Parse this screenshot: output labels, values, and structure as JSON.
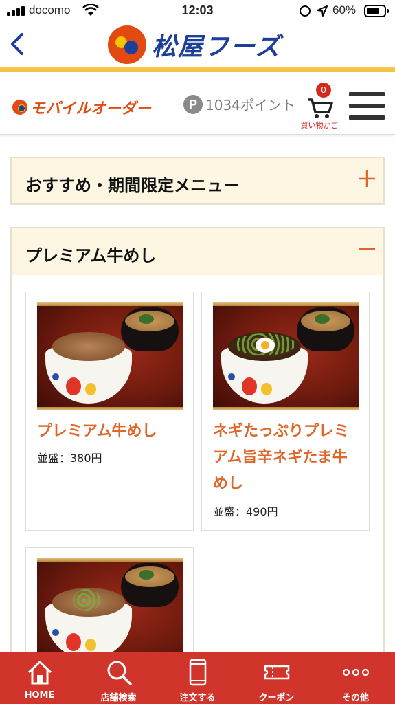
{
  "status_bar": {
    "carrier": "docomo",
    "time": "12:03",
    "battery": "60%"
  },
  "header": {
    "brand_name": "松屋フーズ"
  },
  "subheader": {
    "mobile_order_label": "モバイルオーダー",
    "points_symbol": "P",
    "points": "1034ポイント",
    "cart_count": "0",
    "cart_label": "買い物かご"
  },
  "sections": [
    {
      "title": "おすすめ・期間限定メニュー",
      "toggle": "+"
    },
    {
      "title": "プレミアム牛めし",
      "toggle": "−"
    }
  ],
  "items": [
    {
      "name": "プレミアム牛めし",
      "price": "並盛：380円"
    },
    {
      "name": "ネギたっぷりプレミアム旨辛ネギたま牛めし",
      "price": "並盛：490円"
    },
    {
      "name": "",
      "price": ""
    }
  ],
  "nav": [
    {
      "label": "HOME",
      "icon": "home-icon"
    },
    {
      "label": "店舗検索",
      "icon": "search-icon"
    },
    {
      "label": "注文する",
      "icon": "phone-icon"
    },
    {
      "label": "クーポン",
      "icon": "ticket-icon"
    },
    {
      "label": "その他",
      "icon": "more-icon"
    }
  ],
  "colors": {
    "accent_red": "#d0342a",
    "brand_blue": "#1d3f9a",
    "brand_orange": "#e24a12",
    "item_orange": "#e0672a",
    "section_bg": "#fdf6e3"
  }
}
